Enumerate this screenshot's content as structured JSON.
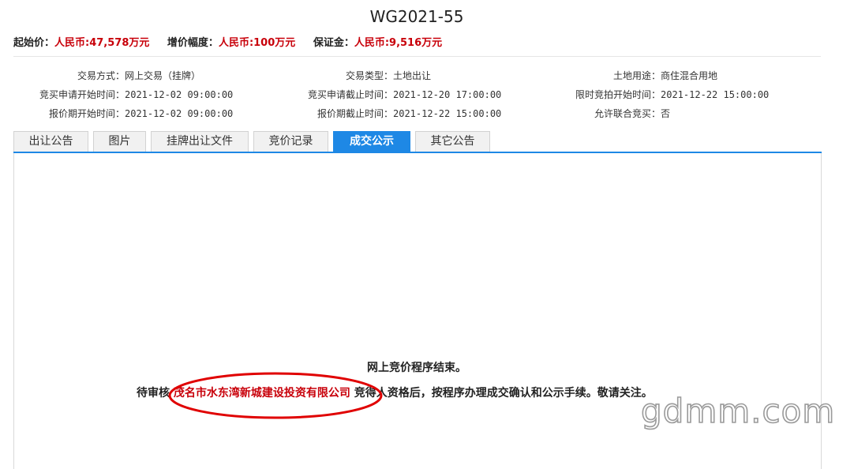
{
  "title": "WG2021-55",
  "price_bar": {
    "start_price_label": "起始价：",
    "start_price_value": "人民币:47,578万元",
    "increment_label": "增价幅度：",
    "increment_value": "人民币:100万元",
    "deposit_label": "保证金：",
    "deposit_value": "人民币:9,516万元"
  },
  "info": {
    "col1": [
      {
        "label": "交易方式：",
        "value": "网上交易（挂牌）"
      },
      {
        "label": "竞买申请开始时间：",
        "value": "2021-12-02 09:00:00"
      },
      {
        "label": "报价期开始时间：",
        "value": "2021-12-02 09:00:00"
      }
    ],
    "col2": [
      {
        "label": "交易类型：",
        "value": "土地出让"
      },
      {
        "label": "竞买申请截止时间：",
        "value": "2021-12-20 17:00:00"
      },
      {
        "label": "报价期截止时间：",
        "value": "2021-12-22 15:00:00"
      }
    ],
    "col3": [
      {
        "label": "土地用途：",
        "value": "商住混合用地"
      },
      {
        "label": "限时竞拍开始时间：",
        "value": "2021-12-22 15:00:00"
      },
      {
        "label": "允许联合竞买：",
        "value": "否"
      }
    ]
  },
  "tabs": [
    "出让公告",
    "图片",
    "挂牌出让文件",
    "竞价记录",
    "成交公示",
    "其它公告"
  ],
  "active_tab": "成交公示",
  "content": {
    "line1": "网上竞价程序结束。",
    "line2_prefix": "待审核",
    "company": "茂名市水东湾新城建设投资有限公司",
    "line2_suffix": "竞得人资格后，按程序办理成交确认和公示手续。敬请关注。"
  },
  "watermark": "gdmm.com",
  "colors": {
    "accent": "#1e88e5",
    "price_red": "#c8000a",
    "annotation_red": "#e00000"
  }
}
